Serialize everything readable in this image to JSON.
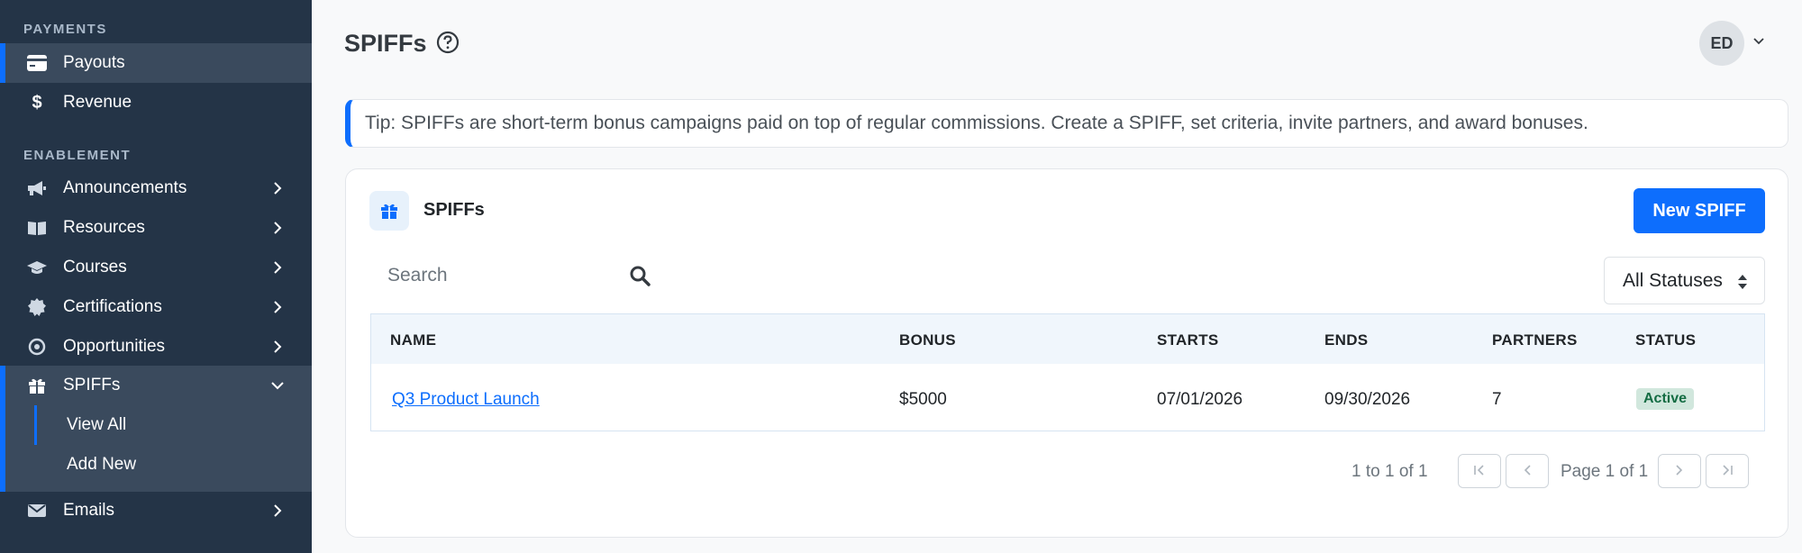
{
  "sidebar": {
    "payments_label": "PAYMENTS",
    "enablement_label": "ENABLEMENT",
    "items": {
      "payouts": "Payouts",
      "revenue": "Revenue",
      "announcements": "Announcements",
      "resources": "Resources",
      "courses": "Courses",
      "certifications": "Certifications",
      "opportunities": "Opportunities",
      "spiffs": "SPIFFs",
      "view_all": "View All",
      "add_new": "Add New",
      "emails": "Emails"
    }
  },
  "header": {
    "title": "SPIFFs",
    "avatar_initials": "ED"
  },
  "tip": "Tip: SPIFFs are short-term bonus campaigns paid on top of regular commissions. Create a SPIFF, set criteria, invite partners, and award bonuses.",
  "card": {
    "title": "SPIFFs",
    "new_button": "New SPIFF",
    "search_placeholder": "Search",
    "status_filter": "All Statuses",
    "columns": {
      "name": "NAME",
      "bonus": "BONUS",
      "starts": "STARTS",
      "ends": "ENDS",
      "partners": "PARTNERS",
      "status": "STATUS"
    },
    "rows": [
      {
        "name": "Q3 Product Launch",
        "bonus": "$5000",
        "starts": "07/01/2026",
        "ends": "09/30/2026",
        "partners": "7",
        "status": "Active"
      }
    ],
    "pagination": {
      "range": "1 to 1 of 1",
      "page": "Page 1 of 1"
    }
  },
  "colors": {
    "sidebar_bg": "#243447",
    "accent": "#0d6efd",
    "active_badge": "#d1e7dd"
  }
}
